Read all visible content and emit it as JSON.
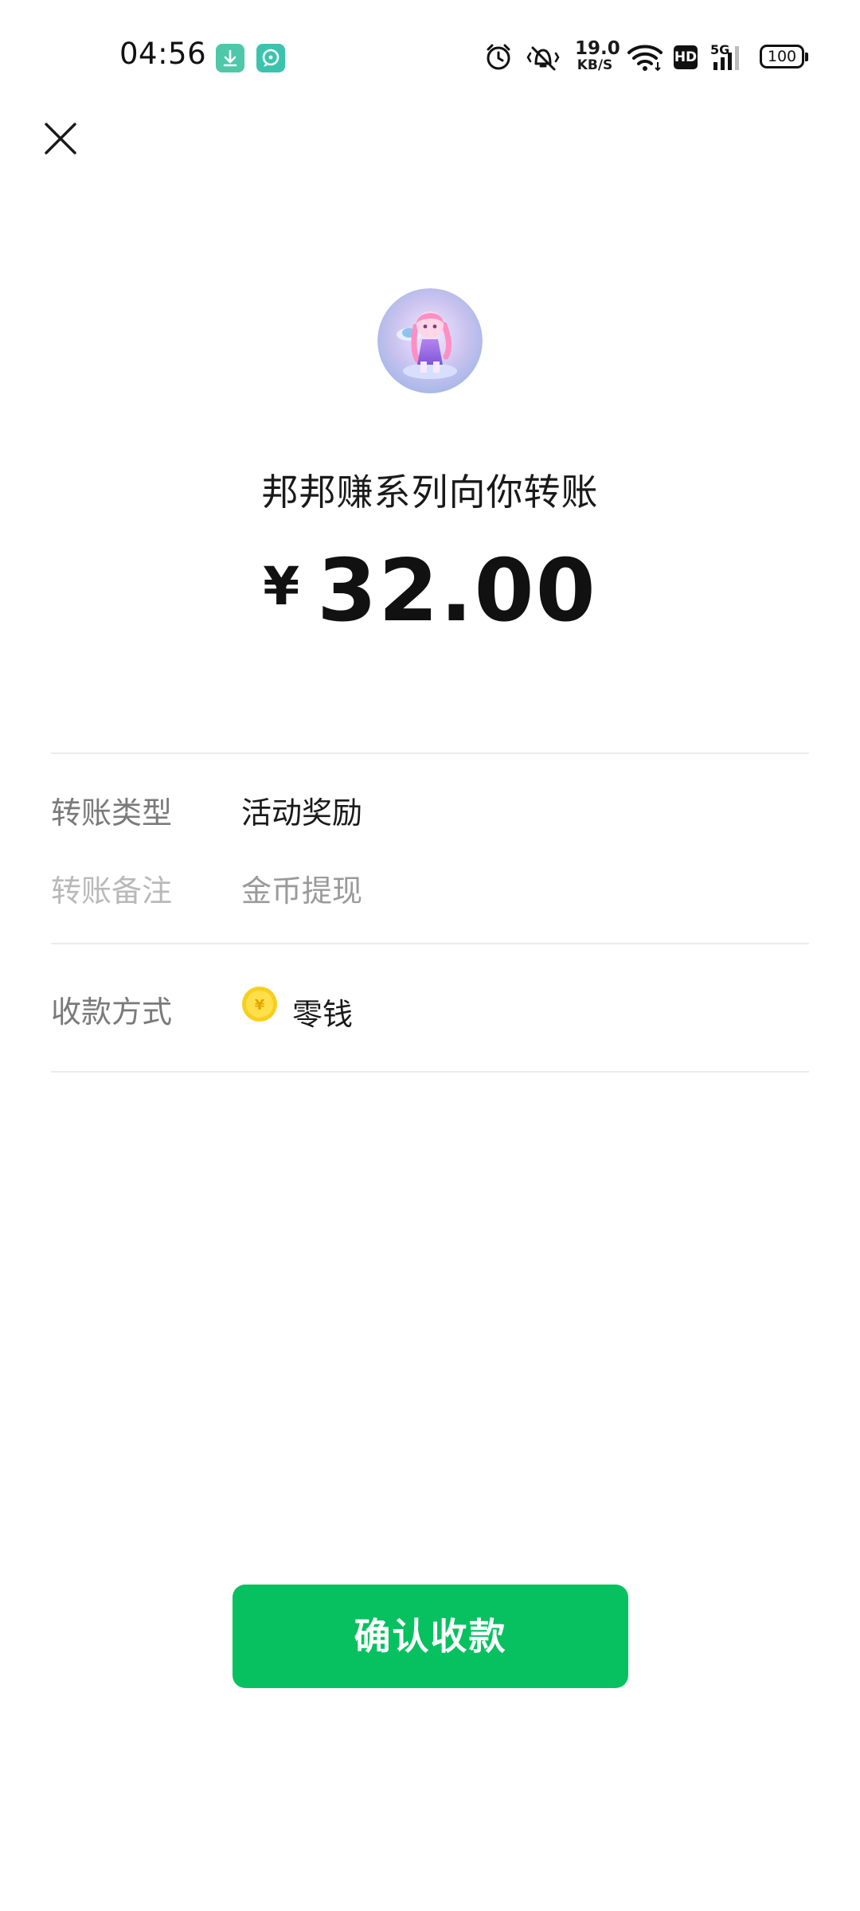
{
  "status_bar": {
    "time": "04:56",
    "app_icons": [
      "download-app-icon",
      "chat-app-icon"
    ],
    "net_speed_value": "19.0",
    "net_speed_unit": "KB/S",
    "hd_label": "HD",
    "network_label": "5G",
    "battery": "100"
  },
  "header": {
    "close_icon": "close-icon"
  },
  "transfer": {
    "title": "邦邦赚系列向你转账",
    "currency_symbol": "¥",
    "amount": "32.00"
  },
  "details": {
    "type_label": "转账类型",
    "type_value": "活动奖励",
    "note_label": "转账备注",
    "note_value": "金币提现",
    "method_label": "收款方式",
    "method_icon": "coin-icon",
    "method_value": "零钱"
  },
  "actions": {
    "confirm_label": "确认收款"
  },
  "colors": {
    "primary": "#07c160",
    "coin": "#f5c800"
  }
}
